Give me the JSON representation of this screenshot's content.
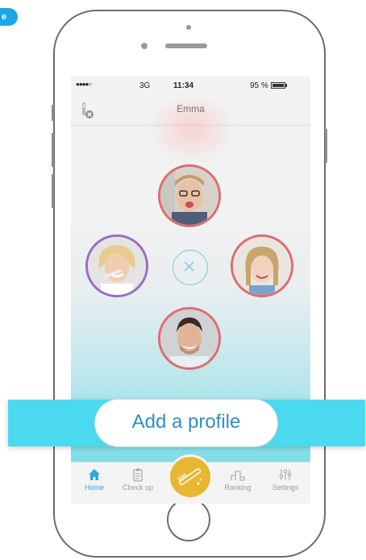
{
  "corner_badge": "e",
  "status_bar": {
    "signal": "●●●●○",
    "network": "3G",
    "time": "11:34",
    "battery": "95 %"
  },
  "nav": {
    "title": "Emma"
  },
  "tabs": [
    {
      "label": "Home",
      "icon": "house-icon",
      "active": true
    },
    {
      "label": "Check up",
      "icon": "clipboard-icon",
      "active": false
    },
    {
      "label": "",
      "icon": "toothbrush-icon",
      "active": false
    },
    {
      "label": "Ranking",
      "icon": "podium-icon",
      "active": false
    },
    {
      "label": "Settings",
      "icon": "sliders-icon",
      "active": false
    }
  ],
  "add_profile_label": "Add a profile",
  "colors": {
    "accent": "#2aa8df",
    "profile_band": "#4bd9ef",
    "brush_button": "#e8b730",
    "ring_red": "#e06b6f",
    "ring_purple": "#9b6cc4"
  }
}
